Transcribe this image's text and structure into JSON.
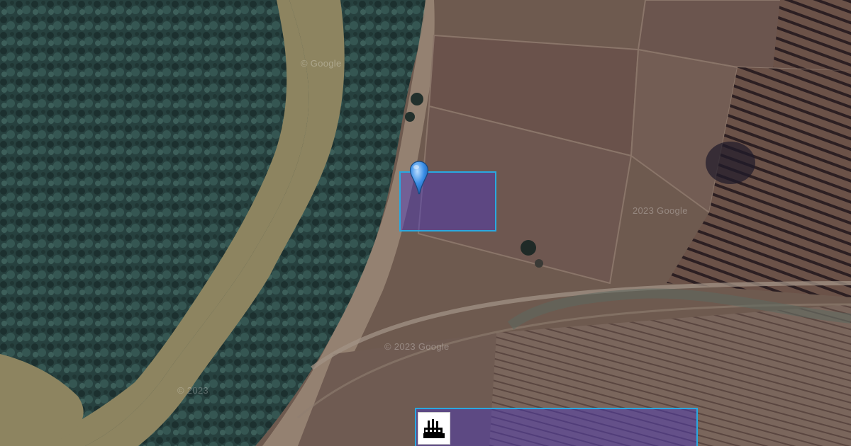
{
  "map": {
    "view": "satellite",
    "attribution": "© Google",
    "watermarks": [
      "© Google",
      "2023 Google",
      "© 2023 Google",
      "© 2023"
    ]
  },
  "overlays": [
    {
      "name": "zone-upper",
      "fill": "#4632c8",
      "stroke": "#29a8e0"
    },
    {
      "name": "zone-lower",
      "fill": "#4632c8",
      "stroke": "#29a8e0"
    }
  ],
  "marker": {
    "icon": "map-pin-icon",
    "color": "#3a8ee6"
  },
  "poi": {
    "icon": "factory-icon",
    "background": "#ffffff"
  },
  "colors": {
    "forest": "#27413f",
    "river": "#8d8460",
    "field": "#6e5a4f",
    "sand": "#9b8877"
  }
}
